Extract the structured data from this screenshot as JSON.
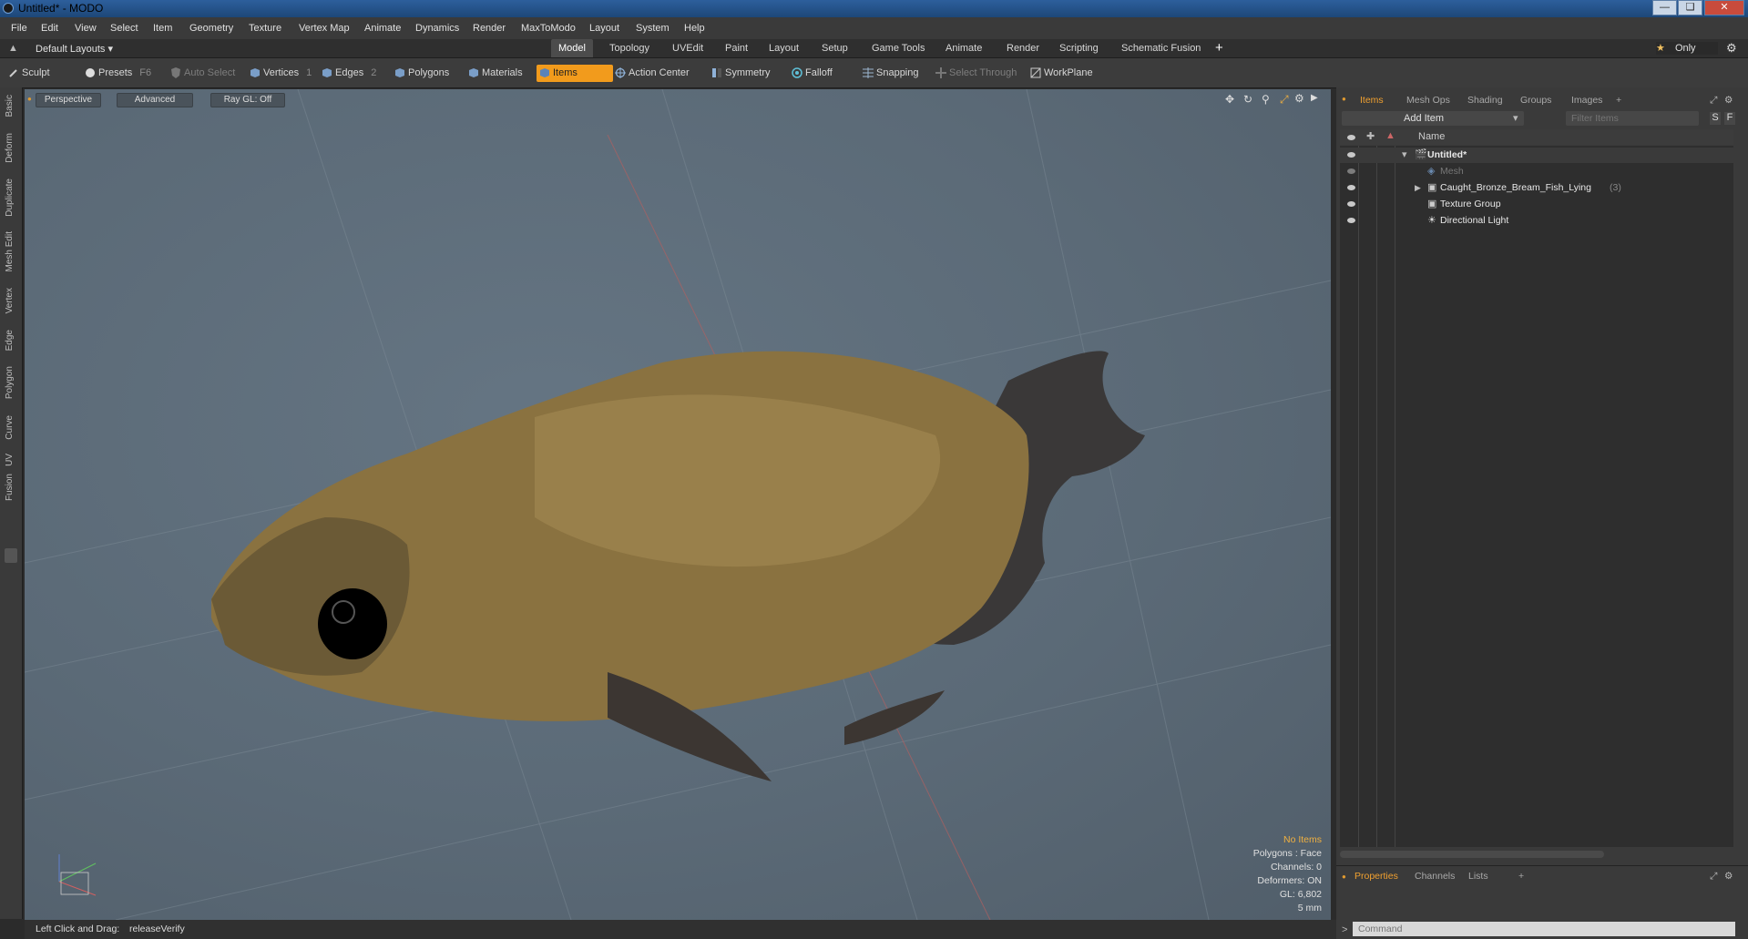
{
  "window": {
    "title": "Untitled* - MODO"
  },
  "menubar": [
    "File",
    "Edit",
    "View",
    "Select",
    "Item",
    "Geometry",
    "Texture",
    "Vertex Map",
    "Animate",
    "Dynamics",
    "Render",
    "MaxToModo",
    "Layout",
    "System",
    "Help"
  ],
  "layouts": {
    "selector": "Default Layouts",
    "tabs": [
      "Model",
      "Topology",
      "UVEdit",
      "Paint",
      "Layout",
      "Setup",
      "Game Tools",
      "Animate",
      "Render",
      "Scripting",
      "Schematic Fusion"
    ],
    "active": "Model",
    "add": "+",
    "only_label": "Only"
  },
  "toolbar": {
    "sculpt": "Sculpt",
    "presets": "Presets",
    "presets_key": "F6",
    "auto_select": "Auto Select",
    "vertices": "Vertices",
    "vertices_key": "1",
    "edges": "Edges",
    "edges_key": "2",
    "polygons": "Polygons",
    "materials": "Materials",
    "items": "Items",
    "action_center": "Action Center",
    "symmetry": "Symmetry",
    "falloff": "Falloff",
    "snapping": "Snapping",
    "select_through": "Select Through",
    "workplane": "WorkPlane"
  },
  "left_tabs": [
    "Basic",
    "Deform",
    "Duplicate",
    "Mesh Edit",
    "Vertex",
    "Edge",
    "Polygon",
    "Curve",
    "UV",
    "Fusion"
  ],
  "viewport": {
    "view": "Perspective",
    "shading": "Advanced",
    "raygl": "Ray GL: Off",
    "info": {
      "selection": "No Items",
      "polygons": "Polygons : Face",
      "channels": "Channels: 0",
      "deformers": "Deformers: ON",
      "gl": "GL: 6,802",
      "scale": "5 mm"
    }
  },
  "items_panel": {
    "tabs": [
      "Items",
      "Mesh Ops",
      "Shading",
      "Groups",
      "Images"
    ],
    "active_tab": "Items",
    "add_item": "Add Item",
    "filter_placeholder": "Filter Items",
    "s_btn": "S",
    "f_btn": "F",
    "column_name": "Name",
    "rows": [
      {
        "label": "Untitled*",
        "count": ""
      },
      {
        "label": "Mesh",
        "count": ""
      },
      {
        "label": "Caught_Bronze_Bream_Fish_Lying",
        "count": "(3)"
      },
      {
        "label": "Texture Group",
        "count": ""
      },
      {
        "label": "Directional Light",
        "count": ""
      }
    ]
  },
  "properties_panel": {
    "tabs": [
      "Properties",
      "Channels",
      "Lists"
    ],
    "active_tab": "Properties"
  },
  "command": {
    "placeholder": "Command"
  },
  "status": {
    "hint": "Left Click and Drag:",
    "action": "releaseVerify"
  }
}
